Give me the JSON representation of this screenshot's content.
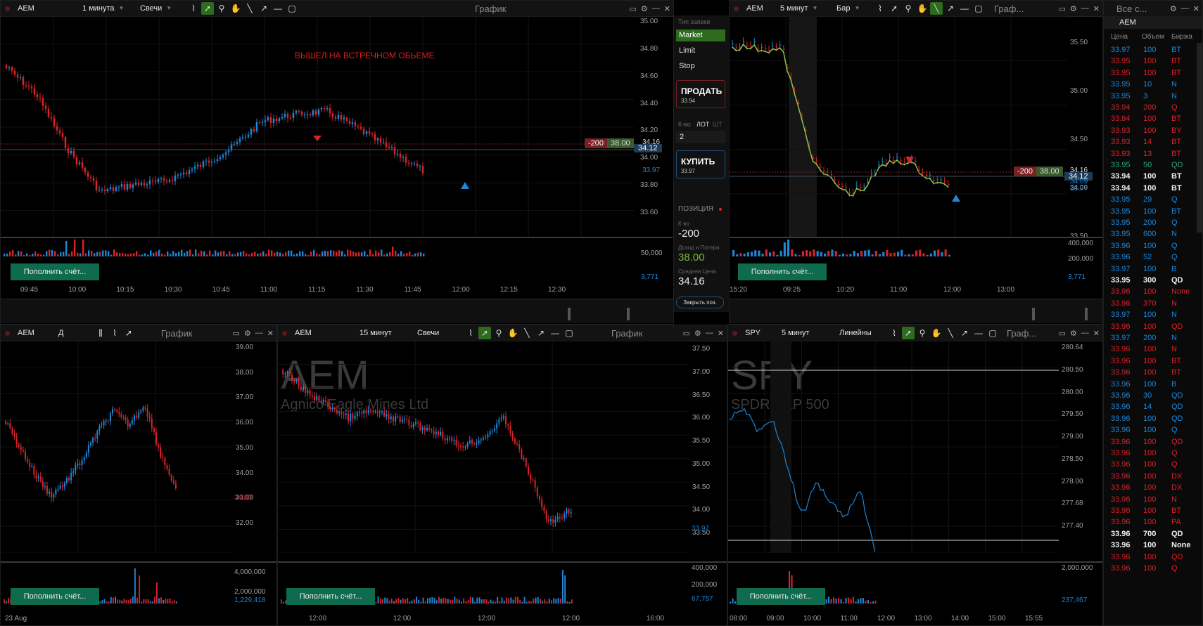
{
  "colors": {
    "up": "#1e86d8",
    "down": "#d8232a",
    "green": "#2e6b1e",
    "deposit": "#0f6b4e"
  },
  "common": {
    "deposit_label": "Пополнить счёт..."
  },
  "p1": {
    "symbol": "AEM",
    "interval": "1 минута",
    "chart_type": "Свечи",
    "title": "График",
    "annotation": "ВЫШЕЛ НА ВСТРЕЧНОМ ОБЬЕМЕ",
    "y_ticks": [
      "35.00",
      "34.80",
      "34.60",
      "34.40",
      "34.20",
      "34.00",
      "33.80",
      "33.60"
    ],
    "pos_qty": "-200",
    "pos_pl": "38.00",
    "price_tag": "34.12",
    "price_a": "34.16",
    "price_b": "33.97",
    "vol_ticks": [
      "50,000",
      "3,771"
    ],
    "x_ticks": [
      "09:45",
      "10:00",
      "10:15",
      "10:30",
      "10:45",
      "11:00",
      "11:15",
      "11:30",
      "11:45",
      "12:00",
      "12:15",
      "12:30"
    ]
  },
  "order": {
    "type_label": "Тип заявки",
    "types": [
      "Market",
      "Limit",
      "Stop"
    ],
    "sell_label": "ПРОДАТЬ",
    "sell_price": "33.94",
    "qty_label": "К-во",
    "lot": "ЛОТ",
    "sht": "ШТ",
    "qty": "2",
    "buy_label": "КУПИТЬ",
    "buy_price": "33.97",
    "position_label": "ПОЗИЦИЯ",
    "pos_qty_label": "К-во",
    "pos_qty": "-200",
    "pl_label": "Доход и Потери",
    "pl": "38.00",
    "avg_label": "Средняя Цена",
    "avg": "34.16",
    "close_label": "Закрыть поз."
  },
  "p2": {
    "symbol": "AEM",
    "interval": "5 минут",
    "chart_type": "Бар",
    "title": "Граф...",
    "y_ticks": [
      "35.50",
      "35.00",
      "34.50",
      "34.00",
      "33.50"
    ],
    "pos_qty": "-200",
    "pos_pl": "38.00",
    "price_tag": "34.12",
    "price_a": "34.16",
    "price_b": "34.09",
    "price_c": "33.97",
    "vol_ticks": [
      "400,000",
      "200,000",
      "3,771"
    ],
    "x_ticks": [
      "15:20",
      "09:25",
      "10:20",
      "11:00",
      "12:00",
      "13:00"
    ]
  },
  "book": {
    "title": "Все с...",
    "symbol": "AEM",
    "headers": [
      "Цена",
      "Объем",
      "Биржа"
    ],
    "rows": [
      [
        "33.97",
        "100",
        "BT",
        "b"
      ],
      [
        "33.95",
        "100",
        "BT",
        "r"
      ],
      [
        "33.95",
        "100",
        "BT",
        "r"
      ],
      [
        "33.95",
        "10",
        "N",
        "b"
      ],
      [
        "33.95",
        "3",
        "N",
        "b"
      ],
      [
        "33.94",
        "200",
        "Q",
        "r"
      ],
      [
        "33.94",
        "100",
        "BT",
        "r"
      ],
      [
        "33.93",
        "100",
        "BY",
        "r"
      ],
      [
        "33.93",
        "14",
        "BT",
        "r"
      ],
      [
        "33.93",
        "13",
        "BT",
        "r"
      ],
      [
        "33.95",
        "50",
        "QD",
        "g"
      ],
      [
        "33.94",
        "100",
        "BT",
        "w"
      ],
      [
        "33.94",
        "100",
        "BT",
        "w"
      ],
      [
        "33.95",
        "29",
        "Q",
        "b"
      ],
      [
        "33.95",
        "100",
        "BT",
        "b"
      ],
      [
        "33.95",
        "200",
        "Q",
        "b"
      ],
      [
        "33.95",
        "600",
        "N",
        "b"
      ],
      [
        "33.96",
        "100",
        "Q",
        "b"
      ],
      [
        "33.96",
        "52",
        "Q",
        "b"
      ],
      [
        "33.97",
        "100",
        "B",
        "b"
      ],
      [
        "33.95",
        "300",
        "QD",
        "w"
      ],
      [
        "33.96",
        "100",
        "None",
        "r"
      ],
      [
        "33.96",
        "370",
        "N",
        "r"
      ],
      [
        "33.97",
        "100",
        "N",
        "b"
      ],
      [
        "33.96",
        "100",
        "QD",
        "r"
      ],
      [
        "33.97",
        "200",
        "N",
        "b"
      ],
      [
        "33.96",
        "100",
        "N",
        "r"
      ],
      [
        "33.96",
        "100",
        "BT",
        "r"
      ],
      [
        "33.96",
        "100",
        "BT",
        "r"
      ],
      [
        "33.96",
        "100",
        "B",
        "b"
      ],
      [
        "33.96",
        "30",
        "QD",
        "b"
      ],
      [
        "33.96",
        "14",
        "QD",
        "b"
      ],
      [
        "33.96",
        "100",
        "QD",
        "b"
      ],
      [
        "33.96",
        "100",
        "Q",
        "b"
      ],
      [
        "33.96",
        "100",
        "QD",
        "r"
      ],
      [
        "33.96",
        "100",
        "Q",
        "r"
      ],
      [
        "33.96",
        "100",
        "Q",
        "r"
      ],
      [
        "33.96",
        "100",
        "DX",
        "r"
      ],
      [
        "33.96",
        "100",
        "DX",
        "r"
      ],
      [
        "33.96",
        "100",
        "N",
        "r"
      ],
      [
        "33.96",
        "100",
        "BT",
        "r"
      ],
      [
        "33.96",
        "100",
        "PA",
        "r"
      ],
      [
        "33.96",
        "700",
        "QD",
        "w"
      ],
      [
        "33.96",
        "100",
        "None",
        "w"
      ],
      [
        "33.96",
        "100",
        "QD",
        "r"
      ],
      [
        "33.96",
        "100",
        "Q",
        "r"
      ]
    ]
  },
  "p3": {
    "symbol": "AEM",
    "interval": "Д",
    "title": "График",
    "y_ticks": [
      "39.00",
      "38.00",
      "37.00",
      "36.00",
      "35.00",
      "34.00",
      "33.00",
      "32.00"
    ],
    "price_a": "34.00",
    "vol_ticks": [
      "4,000,000",
      "2,000,000",
      "1,229,418"
    ],
    "date": "23 Aug"
  },
  "p4": {
    "symbol": "AEM",
    "interval": "15 минут",
    "chart_type": "Свечи",
    "title": "График",
    "watermark_symbol": "AEM",
    "watermark_name": "Agnico Eagle Mines Ltd",
    "y_ticks": [
      "37.50",
      "37.00",
      "36.50",
      "36.00",
      "35.50",
      "35.00",
      "34.50",
      "34.00",
      "33.50"
    ],
    "price_a": "33.97",
    "vol_ticks": [
      "400,000",
      "200,000",
      "67,757"
    ],
    "x_ticks": [
      "12:00",
      "12:00",
      "12:00",
      "12:00",
      "16:00"
    ]
  },
  "p5": {
    "symbol": "SPY",
    "interval": "5 минут",
    "chart_type": "Линейны",
    "title": "Граф...",
    "watermark_symbol": "SPY",
    "watermark_name": "SPDR S&P 500",
    "y_ticks": [
      "280.64",
      "280.50",
      "280.00",
      "279.50",
      "279.00",
      "278.50",
      "278.00",
      "277.68",
      "277.40"
    ],
    "vol_ticks": [
      "2,000,000",
      "237,467"
    ],
    "x_ticks": [
      "08:00",
      "09:00",
      "10:00",
      "11:00",
      "12:00",
      "13:00",
      "14:00",
      "15:00",
      "15:55"
    ]
  }
}
